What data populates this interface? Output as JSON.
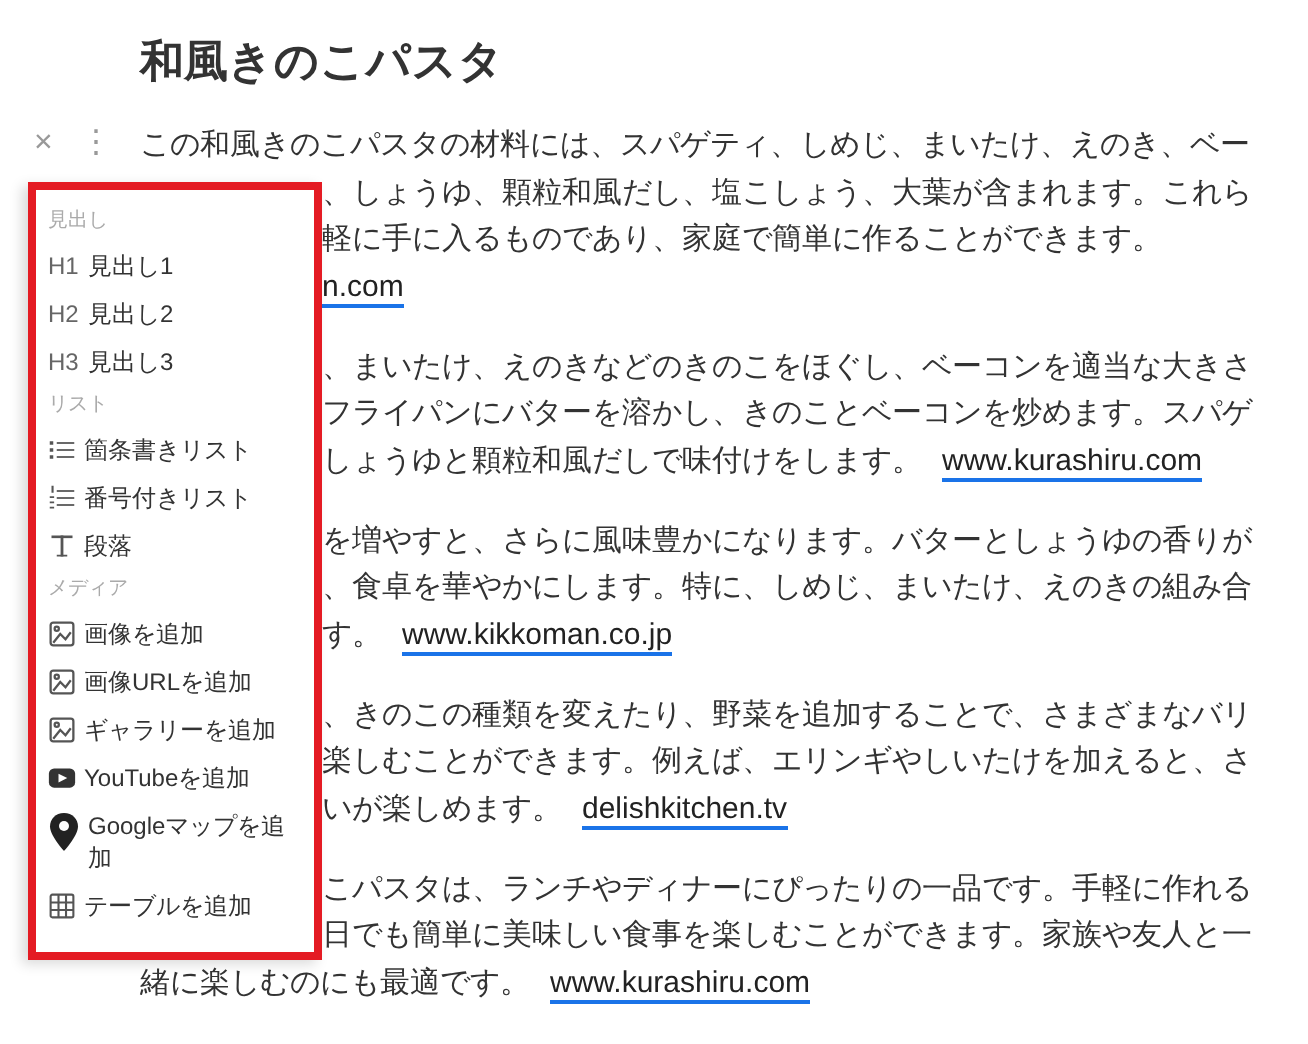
{
  "title": "和風きのこパスタ",
  "block_controls": {
    "close": "×",
    "more": "⋮"
  },
  "paragraphs": [
    {
      "lines": [
        {
          "covered": false,
          "text": "この和風きのこパスタの材料には、スパゲティ、しめじ、まいたけ、えのき、ベー"
        },
        {
          "covered": true,
          "text": "、しょうゆ、顆粒和風だし、塩こしょう、大葉が含まれます。これら"
        },
        {
          "covered": true,
          "text": "軽に手に入るものであり、家庭で簡単に作ることができます。"
        },
        {
          "covered": true,
          "link": "n.com"
        }
      ]
    },
    {
      "lines": [
        {
          "covered": true,
          "text": "、まいたけ、えのきなどのきのこをほぐし、ベーコンを適当な大きさ"
        },
        {
          "covered": true,
          "text": "フライパンにバターを溶かし、きのことベーコンを炒めます。スパゲ"
        },
        {
          "covered": true,
          "text": "しょうゆと顆粒和風だしで味付けをします。",
          "link": "www.kurashiru.com"
        }
      ]
    },
    {
      "lines": [
        {
          "covered": true,
          "text": "を増やすと、さらに風味豊かになります。バターとしょうゆの香りが"
        },
        {
          "covered": true,
          "text": "、食卓を華やかにします。特に、しめじ、まいたけ、えのきの組み合"
        },
        {
          "covered": true,
          "text": "す。",
          "link": "www.kikkoman.co.jp"
        }
      ]
    },
    {
      "lines": [
        {
          "covered": true,
          "text": "、きのこの種類を変えたり、野菜を追加することで、さまざまなバリ"
        },
        {
          "covered": true,
          "text": "楽しむことができます。例えば、エリンギやしいたけを加えると、さ"
        },
        {
          "covered": true,
          "text": "いが楽しめます。",
          "link": "delishkitchen.tv"
        }
      ]
    },
    {
      "lines": [
        {
          "covered": true,
          "text": "こパスタは、ランチやディナーにぴったりの一品です。手軽に作れる"
        },
        {
          "covered": true,
          "text": "日でも簡単に美味しい食事を楽しむことができます。家族や友人と一"
        },
        {
          "covered": false,
          "text": "緒に楽しむのにも最適です。",
          "link": "www.kurashiru.com"
        }
      ]
    }
  ],
  "block_menu": [
    {
      "kind": "section",
      "label": "見出し"
    },
    {
      "kind": "heading",
      "prefix": "H1",
      "label": "見出し1"
    },
    {
      "kind": "heading",
      "prefix": "H2",
      "label": "見出し2"
    },
    {
      "kind": "heading",
      "prefix": "H3",
      "label": "見出し3"
    },
    {
      "kind": "section",
      "label": "リスト"
    },
    {
      "kind": "bullets",
      "label": "箇条書きリスト"
    },
    {
      "kind": "numbers",
      "label": "番号付きリスト"
    },
    {
      "kind": "text",
      "label": "段落"
    },
    {
      "kind": "section",
      "label": "メディア"
    },
    {
      "kind": "image",
      "label": "画像を追加"
    },
    {
      "kind": "image",
      "label": "画像URLを追加"
    },
    {
      "kind": "image",
      "label": "ギャラリーを追加"
    },
    {
      "kind": "video",
      "label": "YouTubeを追加"
    },
    {
      "kind": "pin",
      "label": "Googleマップを追加"
    },
    {
      "kind": "grid",
      "label": "テーブルを追加"
    }
  ]
}
